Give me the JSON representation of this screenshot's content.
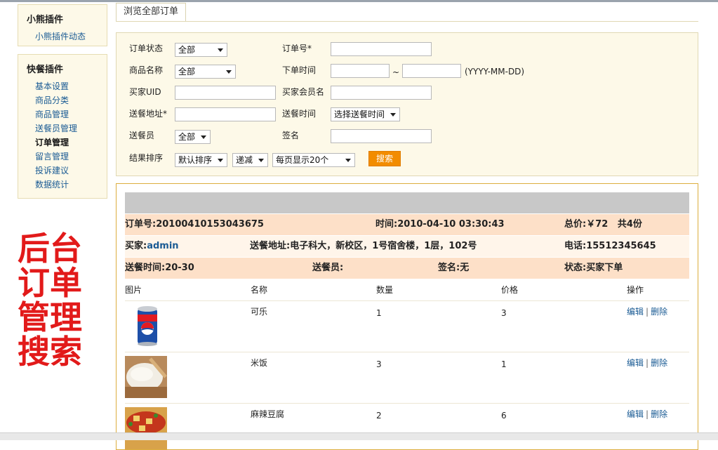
{
  "sidebar": {
    "group1": {
      "title": "小熊插件",
      "items": [
        "小熊插件动态"
      ]
    },
    "group2": {
      "title": "快餐插件",
      "items": [
        "基本设置",
        "商品分类",
        "商品管理",
        "送餐员管理",
        "订单管理",
        "留言管理",
        "投诉建议",
        "数据统计"
      ],
      "active_index": 4
    }
  },
  "annotation": [
    "后台",
    "订单",
    "管理",
    "搜索"
  ],
  "tab": {
    "label": "浏览全部订单"
  },
  "search": {
    "order_status_label": "订单状态",
    "order_status_value": "全部",
    "order_no_label": "订单号*",
    "product_label": "商品名称",
    "product_value": "全部",
    "order_time_label": "下单时间",
    "date_sep": "~",
    "date_hint": "(YYYY-MM-DD)",
    "buyer_uid_label": "买家UID",
    "buyer_member_label": "买家会员名",
    "address_label": "送餐地址*",
    "delivery_time_label": "送餐时间",
    "delivery_time_value": "选择送餐时间",
    "courier_label": "送餐员",
    "courier_value": "全部",
    "sign_label": "签名",
    "sort_label": "结果排序",
    "sort_value": "默认排序",
    "order_dir_value": "递减",
    "page_size_value": "每页显示20个",
    "search_button": "搜索"
  },
  "order": {
    "order_no": "订单号:20100410153043675",
    "time": "时间:2010-04-10 03:30:43",
    "total_prefix": "总价:",
    "total": "￥72",
    "count": "共4份",
    "buyer_prefix": "买家:",
    "buyer": "admin",
    "address": "送餐地址:电子科大，新校区，1号宿舍楼，1层，102号",
    "phone": "电话:15512345645",
    "delivery_time": "送餐时间:20-30",
    "courier": "送餐员:",
    "sign": "签名:无",
    "status": "状态:买家下单"
  },
  "table": {
    "headers": {
      "image": "图片",
      "name": "名称",
      "qty": "数量",
      "price": "价格",
      "ops": "操作"
    },
    "rows": [
      {
        "name": "可乐",
        "qty": "1",
        "price": "3"
      },
      {
        "name": "米饭",
        "qty": "3",
        "price": "1"
      },
      {
        "name": "麻辣豆腐",
        "qty": "2",
        "price": "6"
      }
    ],
    "edit_label": "编辑",
    "delete_label": "删除",
    "op_sep": "|"
  },
  "colors": {
    "accent": "#f28c00",
    "link": "#1a5b94",
    "annotation": "#e21a1a",
    "panel_bg": "#fdf9e8",
    "row_peach": "#fde0c8"
  }
}
